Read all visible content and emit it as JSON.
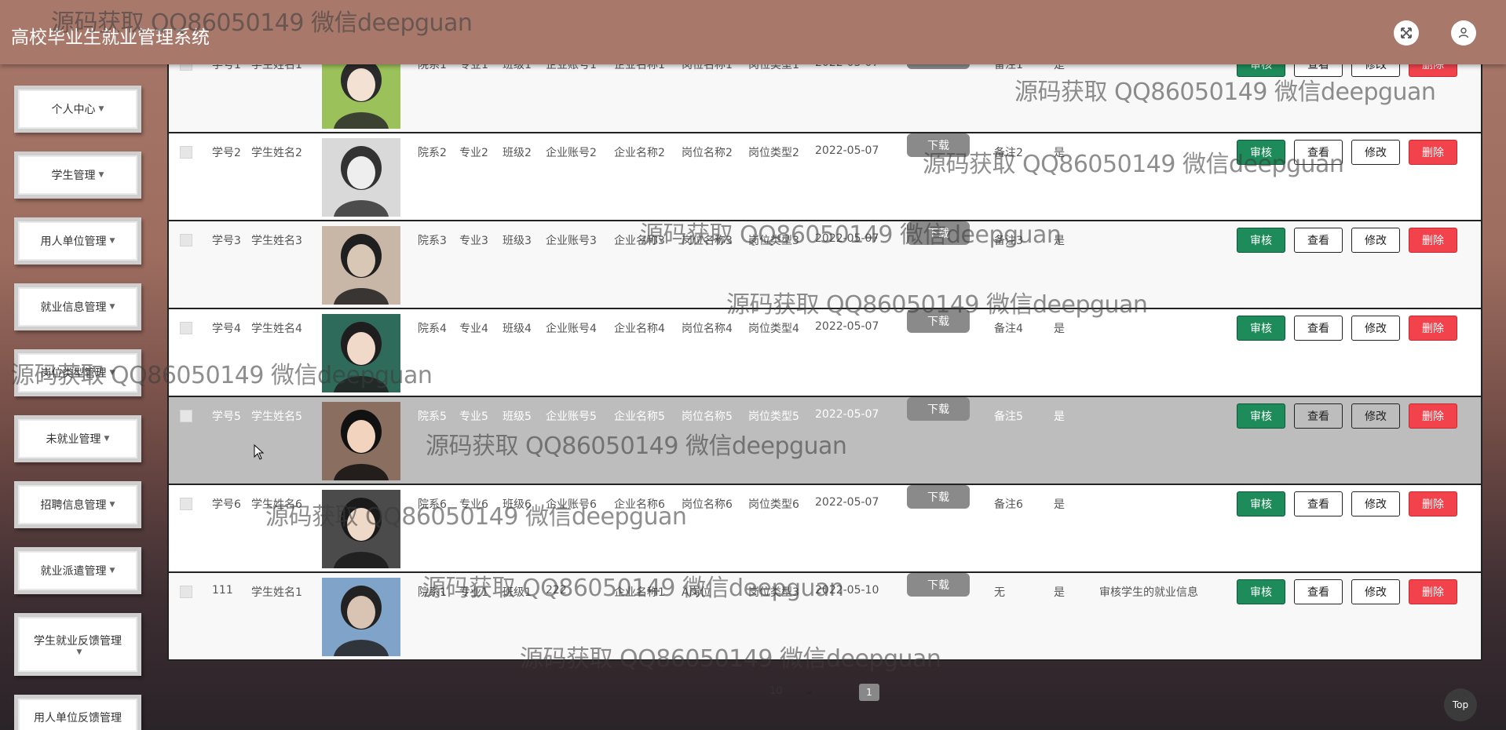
{
  "header": {
    "title": "高校毕业生就业管理系统"
  },
  "icons": {
    "fullscreen": "expand-arrows-icon",
    "user": "user-icon"
  },
  "sidebar": {
    "items": [
      {
        "label": "个人中心"
      },
      {
        "label": "学生管理"
      },
      {
        "label": "用人单位管理"
      },
      {
        "label": "就业信息管理"
      },
      {
        "label": "岗位类型管理"
      },
      {
        "label": "未就业管理"
      },
      {
        "label": "招聘信息管理"
      },
      {
        "label": "就业派遣管理"
      },
      {
        "label": "学生就业反馈管理"
      },
      {
        "label": "用人单位反馈管理"
      }
    ]
  },
  "table": {
    "buttons": {
      "download": "下载",
      "audit": "审核",
      "view": "查看",
      "edit": "修改",
      "delete": "删除"
    },
    "rows": [
      {
        "id": "学号1",
        "name": "学生姓名1",
        "dept": "院系1",
        "major": "专业1",
        "cls": "班级1",
        "acct": "企业账号1",
        "company": "企业名称1",
        "post": "岗位名称1",
        "ptype": "岗位类型1",
        "date": "2022-05-07",
        "note": "备注1",
        "flag": "是",
        "reply": ""
      },
      {
        "id": "学号2",
        "name": "学生姓名2",
        "dept": "院系2",
        "major": "专业2",
        "cls": "班级2",
        "acct": "企业账号2",
        "company": "企业名称2",
        "post": "岗位名称2",
        "ptype": "岗位类型2",
        "date": "2022-05-07",
        "note": "备注2",
        "flag": "是",
        "reply": ""
      },
      {
        "id": "学号3",
        "name": "学生姓名3",
        "dept": "院系3",
        "major": "专业3",
        "cls": "班级3",
        "acct": "企业账号3",
        "company": "企业名称3",
        "post": "岗位名称3",
        "ptype": "岗位类型3",
        "date": "2022-05-07",
        "note": "备注3",
        "flag": "是",
        "reply": ""
      },
      {
        "id": "学号4",
        "name": "学生姓名4",
        "dept": "院系4",
        "major": "专业4",
        "cls": "班级4",
        "acct": "企业账号4",
        "company": "企业名称4",
        "post": "岗位名称4",
        "ptype": "岗位类型4",
        "date": "2022-05-07",
        "note": "备注4",
        "flag": "是",
        "reply": ""
      },
      {
        "id": "学号5",
        "name": "学生姓名5",
        "dept": "院系5",
        "major": "专业5",
        "cls": "班级5",
        "acct": "企业账号5",
        "company": "企业名称5",
        "post": "岗位名称5",
        "ptype": "岗位类型5",
        "date": "2022-05-07",
        "note": "备注5",
        "flag": "是",
        "reply": ""
      },
      {
        "id": "学号6",
        "name": "学生姓名6",
        "dept": "院系6",
        "major": "专业6",
        "cls": "班级6",
        "acct": "企业账号6",
        "company": "企业名称6",
        "post": "岗位名称6",
        "ptype": "岗位类型6",
        "date": "2022-05-07",
        "note": "备注6",
        "flag": "是",
        "reply": ""
      },
      {
        "id": "111",
        "name": "学生姓名1",
        "dept": "院系1",
        "major": "专业1",
        "cls": "班级1",
        "acct": "222",
        "company": "企业名称1",
        "post": "A岗位",
        "ptype": "岗位类型3",
        "date": "2022-05-10",
        "note": "无",
        "flag": "是",
        "reply": "审核学生的就业信息"
      }
    ]
  },
  "pagination": {
    "page_size": "10",
    "current_page": "1"
  },
  "top_button": "Top",
  "watermark": "源码获取 QQ86050149 微信deepguan",
  "colors": {
    "header": "#a8796b",
    "audit": "#1e8c5a",
    "delete": "#f2434d",
    "download": "#8a8a8a"
  }
}
